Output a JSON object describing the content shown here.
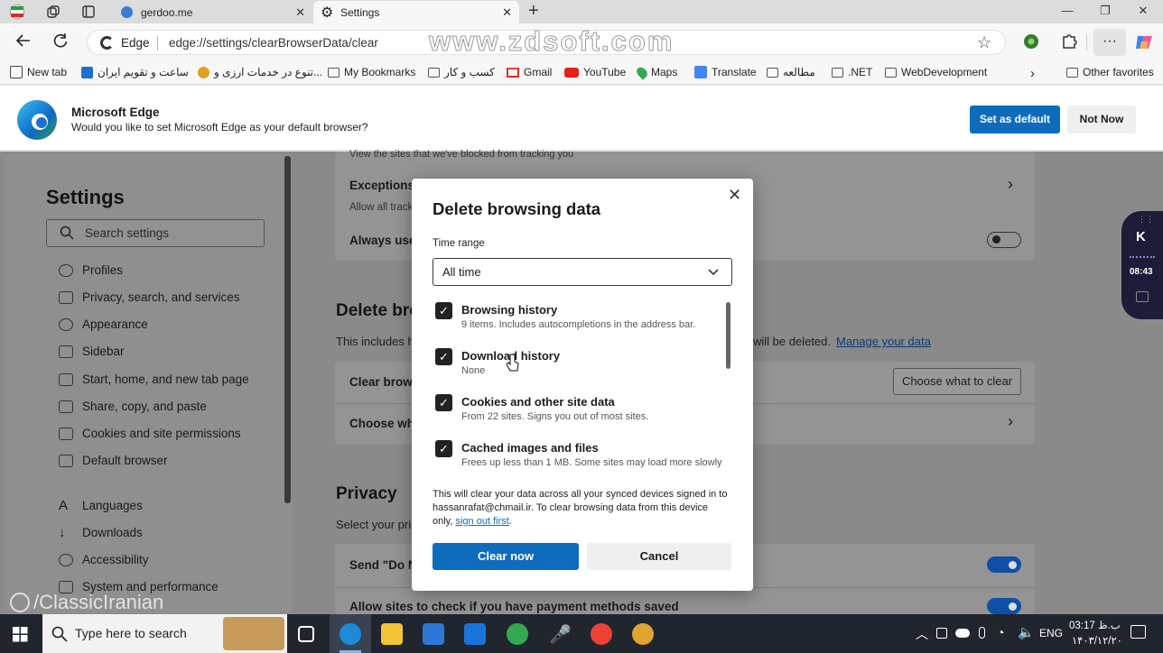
{
  "tabs": [
    {
      "title": "gerdoo.me"
    },
    {
      "title": "Settings"
    }
  ],
  "address": {
    "prefix": "Edge",
    "url": "edge://settings/clearBrowserData/clear"
  },
  "watermark_top": "www.zdsoft.com",
  "watermark_bottom": "/ClassicIranian",
  "bookmarks": [
    "New tab",
    "ساعت و تقویم ایران",
    "تنوع در خدمات ارزی و...",
    "My Bookmarks",
    "کسب و کار",
    "Gmail",
    "YouTube",
    "Maps",
    "Translate",
    "مطالعه",
    ".NET",
    "WebDevelopment",
    "Other favorites"
  ],
  "infobar": {
    "title": "Microsoft Edge",
    "text": "Would you like to set Microsoft Edge as your default browser?",
    "set_default": "Set as default",
    "not_now": "Not Now"
  },
  "sidebar": {
    "title": "Settings",
    "search_placeholder": "Search settings",
    "items": [
      "Profiles",
      "Privacy, search, and services",
      "Appearance",
      "Sidebar",
      "Start, home, and new tab page",
      "Share, copy, and paste",
      "Cookies and site permissions",
      "Default browser",
      "Languages",
      "Downloads",
      "Accessibility",
      "System and performance"
    ]
  },
  "main": {
    "top_text": "View the sites that we've blocked from tracking you",
    "exceptions_title": "Exceptions",
    "exceptions_sub": "Allow all track",
    "always_use": "Always use",
    "delete_heading": "Delete bro",
    "delete_desc": "This includes h",
    "delete_desc_tail": "will be deleted.",
    "manage_link": "Manage your data",
    "clear_row": "Clear brows",
    "choose_btn": "Choose what to clear",
    "choose_row": "Choose wha",
    "privacy_heading": "Privacy",
    "privacy_desc": "Select your pri",
    "send_dnt": "Send \"Do N",
    "payment": "Allow sites to check if you have payment methods saved"
  },
  "dialog": {
    "title": "Delete browsing data",
    "time_range_label": "Time range",
    "time_range_value": "All time",
    "options": [
      {
        "label": "Browsing history",
        "desc": "9 items. Includes autocompletions in the address bar.",
        "checked": true
      },
      {
        "label": "Download history",
        "desc": "None",
        "checked": true
      },
      {
        "label": "Cookies and other site data",
        "desc": "From 22 sites. Signs you out of most sites.",
        "checked": true
      },
      {
        "label": "Cached images and files",
        "desc": "Frees up less than 1 MB. Some sites may load more slowly",
        "checked": true
      }
    ],
    "note_line1": "This will clear your data across all your synced devices signed in to",
    "note_line2": "hassanrafat@chmail.ir. To clear browsing data from this device",
    "note_line3": "only,",
    "note_link": "sign out first",
    "clear_now": "Clear now",
    "cancel": "Cancel"
  },
  "widget": {
    "letter": "K",
    "time": "08:43"
  },
  "taskbar": {
    "search_placeholder": "Type here to search",
    "lang": "ENG",
    "time": "03:17 ب.ظ",
    "date": "۱۴۰۳/۱۲/۲۰"
  },
  "colors": {
    "accent": "#0f6cbd",
    "toggle_on": "#0f4fa8"
  }
}
